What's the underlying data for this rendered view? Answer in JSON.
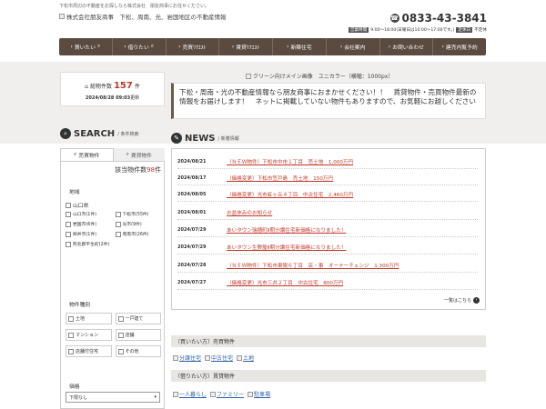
{
  "header": {
    "top_note": "下松市周辺の不動産をお探しなら株式会社　朋友商事にお任せください。",
    "logo_alt": "株式会社朋友商事　下松、周南、光、岩国地区の不動産情報",
    "phone": "0833-43-3841",
    "hours_label": "営業時間",
    "hours": "9:00～18:00(日曜日は10:00～17:00です。)",
    "closed_label": "定休日",
    "closed": "不定休"
  },
  "nav": [
    {
      "label": "買いたい",
      "icon": "search-icon"
    },
    {
      "label": "借りたい",
      "icon": "search-icon"
    },
    {
      "label": "売買ﾘｸｴｽﾄ",
      "icon": "arrow-icon"
    },
    {
      "label": "賃貸ﾘｸｴｽﾄ",
      "icon": "arrow-icon"
    },
    {
      "label": "新築住宅",
      "icon": "arrow-icon"
    },
    {
      "label": "会社案内",
      "icon": "arrow-icon"
    },
    {
      "label": "お問い合わせ",
      "icon": "arrow-icon"
    },
    {
      "label": "建売内覧予約",
      "icon": "arrow-icon"
    }
  ],
  "stock": {
    "label": "総物件数",
    "count": "157",
    "unit": "件",
    "date": "2024/08/28 09:03",
    "date_suffix": "更新"
  },
  "main_image_alt": "クリーン向けメイン画像　ユニカラー（横幅：1000px）",
  "notice": "下松・周南・光の不動産情報なら朋友商事におまかせください！！　賃貸物件・売買物件最新の情報をお届けします！　ネットに掲載していない物件もありますので、お気軽にお越しください",
  "search": {
    "title": "SEARCH",
    "subtitle": "/ 条件検索",
    "tab_sale": "売買物件",
    "tab_rent": "賃貸物件",
    "result_prefix": "該当物件数",
    "result_count": "98",
    "result_suffix": "件",
    "area_label": "地域",
    "prefecture": "山口県",
    "cities": [
      "山口市(1件)",
      "下松市(55件)",
      "岩国市(6件)",
      "光市(9件)",
      "柳井市(1件)",
      "周南市(26件)",
      "熊毛郡平生町(2件)"
    ],
    "type_label": "物件種別",
    "types": [
      "土地",
      "一戸建て",
      "マンション",
      "店舗",
      "店舗付住宅",
      "その他"
    ],
    "price_label": "価格",
    "price_select": "下限なし"
  },
  "news": {
    "title": "NEWS",
    "subtitle": "/ 新着情報",
    "items": [
      {
        "date": "2024/08/21",
        "title": "（ＮＥＷ物件）下松市中市１丁目　売土地　1,000万円"
      },
      {
        "date": "2024/08/17",
        "title": "（価格変更）下松市笠戸島　売土地　150万円"
      },
      {
        "date": "2024/08/05",
        "title": "（価格変更）光市虹ヶ丘４丁目　中古住宅　2,460万円"
      },
      {
        "date": "2024/08/01",
        "title": "お盆休みのお知らせ"
      },
      {
        "date": "2024/07/29",
        "title": "あいタウン瑞穂町Ⅱ期分譲住宅新価格になりました！"
      },
      {
        "date": "2024/07/29",
        "title": "あいタウン生野屋Ⅱ期分譲住宅新価格になりました！"
      },
      {
        "date": "2024/07/28",
        "title": "（ＮＥＷ物件）下松市東陽６丁目　店・事　オーナーチェンジ　1,300万円"
      },
      {
        "date": "2024/07/27",
        "title": "（価格変更）光市三井２丁目　中古住宅　800万円"
      }
    ],
    "more": "一覧はこちら"
  },
  "sale_band": "（買いたい方）売買物件",
  "sale_links": [
    "分譲住宅",
    "中古住宅",
    "土地"
  ],
  "rent_band": "（借りたい方）賃貸物件",
  "rent_links": [
    "一人暮らし",
    "ファミリー",
    "駐車場"
  ]
}
